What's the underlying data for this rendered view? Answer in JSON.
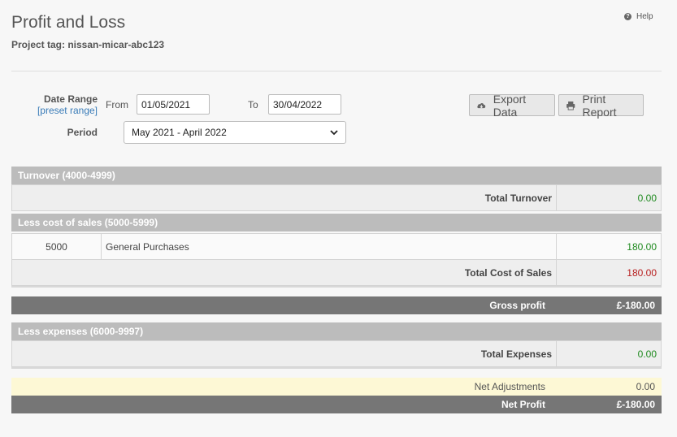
{
  "header": {
    "title": "Profit and Loss",
    "project_tag": "Project tag: nissan-micar-abc123",
    "help_label": "Help"
  },
  "filters": {
    "date_range_label": "Date Range",
    "preset_link": "[preset range]",
    "from_label": "From",
    "from_value": "01/05/2021",
    "to_label": "To",
    "to_value": "30/04/2022",
    "period_label": "Period",
    "period_value": "May 2021 - April 2022"
  },
  "actions": {
    "export_label": "Export Data",
    "print_label": "Print Report"
  },
  "turnover": {
    "heading": "Turnover (4000-4999)",
    "total_label": "Total Turnover",
    "total_value": "0.00"
  },
  "cost_of_sales": {
    "heading": "Less cost of sales (5000-5999)",
    "rows": [
      {
        "code": "5000",
        "description": "General Purchases",
        "value": "180.00"
      }
    ],
    "total_label": "Total Cost of Sales",
    "total_value": "180.00"
  },
  "gross_profit": {
    "label": "Gross profit",
    "value": "£-180.00"
  },
  "expenses": {
    "heading": "Less expenses (6000-9997)",
    "total_label": "Total Expenses",
    "total_value": "0.00"
  },
  "net_adjustments": {
    "label": "Net Adjustments",
    "value": "0.00"
  },
  "net_profit": {
    "label": "Net Profit",
    "value": "£-180.00"
  },
  "colors": {
    "positive": "#1f8a1f",
    "negative": "#b82020",
    "section_header": "#bcbcbc",
    "summary_band": "#767676",
    "adjustment_band": "#fdf8d5",
    "link": "#3a7cb8"
  },
  "icons": {
    "help": "question-circle-icon",
    "export": "cloud-download-icon",
    "print": "printer-icon",
    "select": "chevron-down-icon"
  }
}
